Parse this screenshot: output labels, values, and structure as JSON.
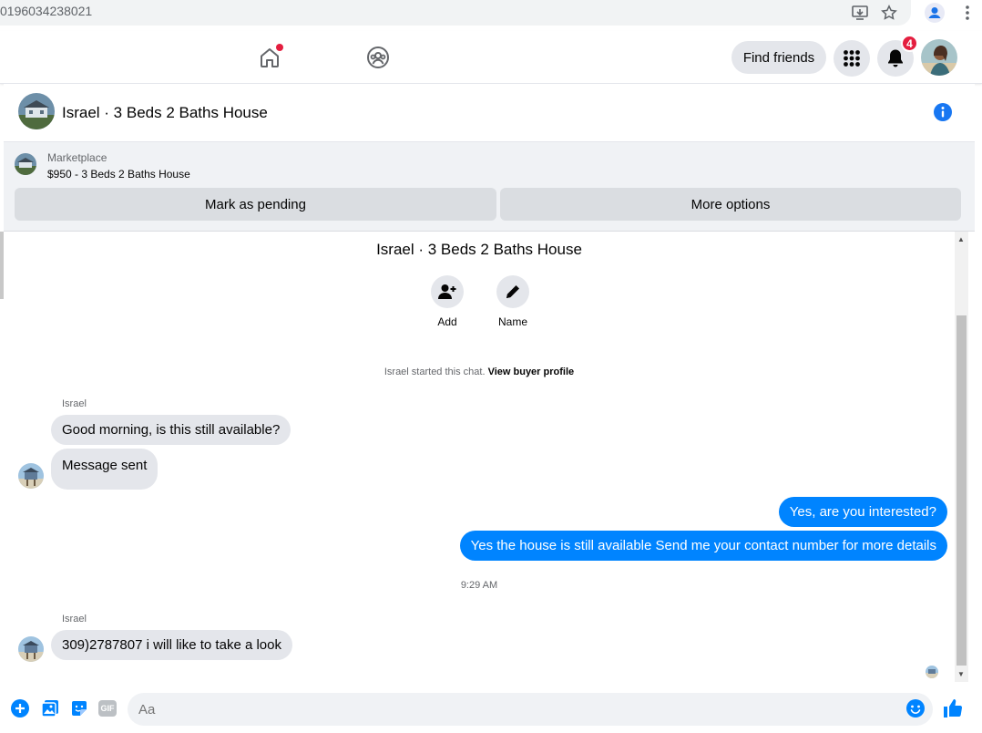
{
  "browser": {
    "url": "0196034238021"
  },
  "nav": {
    "find_friends_label": "Find friends",
    "notification_count": "4"
  },
  "chat": {
    "title": "Israel · 3 Beds 2 Baths House"
  },
  "marketplace": {
    "label": "Marketplace",
    "listing": "$950 - 3 Beds 2 Baths House",
    "mark_pending_label": "Mark as pending",
    "more_options_label": "More options"
  },
  "conversation": {
    "title": "Israel · 3 Beds 2 Baths House",
    "actions": [
      {
        "label": "Add"
      },
      {
        "label": "Name"
      }
    ],
    "started_text": "Israel started this chat.",
    "view_profile_label": "View buyer profile",
    "messages": [
      {
        "sender": "Israel",
        "text": "Good morning, is this still available?"
      },
      {
        "text": "Message sent"
      },
      {
        "text": "Yes, are you interested?"
      },
      {
        "text": "Yes the house is still available Send me your contact number for more details"
      },
      {
        "sender": "Israel",
        "text": "309)2787807 i will like to take a look"
      }
    ],
    "timestamp": "9:29 AM"
  },
  "composer": {
    "placeholder": "Aa",
    "gif_label": "GIF"
  },
  "colors": {
    "accent": "#0084ff",
    "fb_blue": "#1877f2",
    "badge_red": "#e41e3f",
    "bubble_gray": "#e4e6eb",
    "panel_gray": "#f0f2f5"
  }
}
